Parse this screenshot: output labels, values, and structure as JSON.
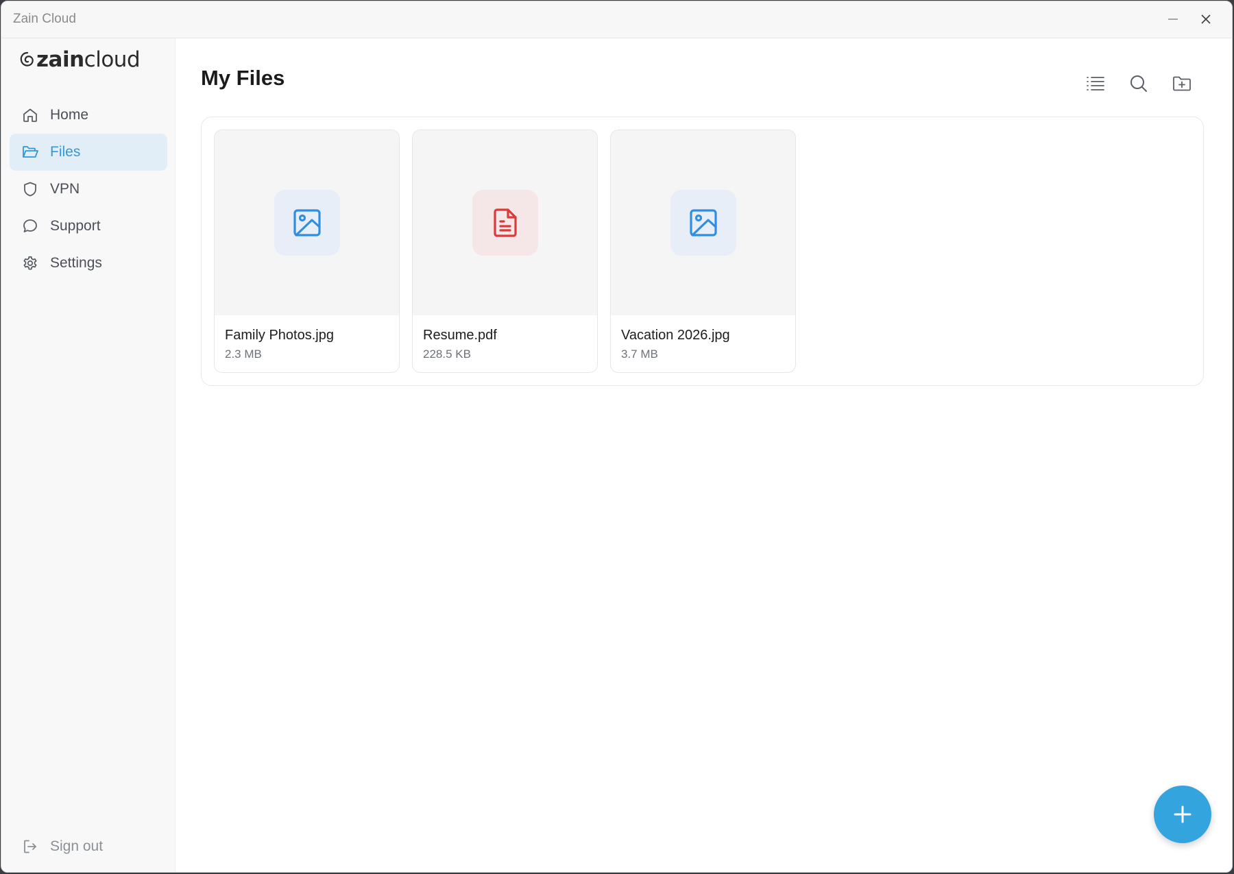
{
  "window": {
    "title": "Zain Cloud"
  },
  "sidebar": {
    "logo": {
      "bold": "zain",
      "light": "cloud"
    },
    "items": [
      {
        "label": "Home",
        "icon": "home-icon",
        "active": false
      },
      {
        "label": "Files",
        "icon": "folder-open-icon",
        "active": true
      },
      {
        "label": "VPN",
        "icon": "shield-icon",
        "active": false
      },
      {
        "label": "Support",
        "icon": "chat-bubble-icon",
        "active": false
      },
      {
        "label": "Settings",
        "icon": "gear-icon",
        "active": false
      }
    ],
    "signout": {
      "label": "Sign out",
      "icon": "sign-out-icon"
    }
  },
  "main": {
    "title": "My Files",
    "toolbar": {
      "list_icon": "list-view-icon",
      "search_icon": "search-icon",
      "new_folder_icon": "new-folder-icon"
    },
    "files": [
      {
        "name": "Family Photos.jpg",
        "size": "2.3 MB",
        "type": "image"
      },
      {
        "name": "Resume.pdf",
        "size": "228.5 KB",
        "type": "pdf"
      },
      {
        "name": "Vacation 2026.jpg",
        "size": "3.7 MB",
        "type": "image"
      }
    ],
    "fab_icon": "plus-icon"
  },
  "colors": {
    "accent": "#33a4de",
    "active_nav_bg": "#e2eef7",
    "active_nav_text": "#3298d6",
    "image_icon": "#2f8ee0",
    "pdf_icon": "#d93a3a"
  }
}
